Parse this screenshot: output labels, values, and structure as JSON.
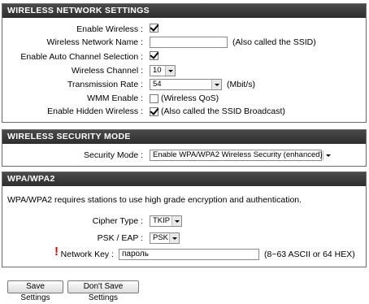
{
  "wireless": {
    "title": "WIRELESS NETWORK SETTINGS",
    "enable_wireless_label": "Enable Wireless :",
    "enable_wireless_checked": true,
    "network_name_label": "Wireless Network Name :",
    "network_name_value": "",
    "network_name_note": "(Also called the SSID)",
    "auto_channel_label": "Enable Auto Channel Selection :",
    "auto_channel_checked": true,
    "channel_label": "Wireless Channel :",
    "channel_value": "10",
    "rate_label": "Transmission Rate :",
    "rate_value": "54",
    "rate_unit": "(Mbit/s)",
    "wmm_label": "WMM Enable :",
    "wmm_checked": false,
    "wmm_note": "(Wireless QoS)",
    "hidden_label": "Enable Hidden Wireless :",
    "hidden_checked": true,
    "hidden_note": "(Also called the SSID Broadcast)"
  },
  "security": {
    "title": "WIRELESS SECURITY MODE",
    "mode_label": "Security Mode :",
    "mode_value": "Enable WPA/WPA2 Wireless Security (enhanced)"
  },
  "wpa": {
    "title": "WPA/WPA2",
    "description": "WPA/WPA2 requires stations to use high grade encryption and authentication.",
    "cipher_label": "Cipher Type :",
    "cipher_value": "TKIP",
    "psk_label": "PSK / EAP :",
    "psk_value": "PSK",
    "key_marker": "!",
    "key_label": "Network Key :",
    "key_value": "пароль",
    "key_note": "(8~63 ASCII or 64 HEX)"
  },
  "buttons": {
    "save": "Save Settings",
    "dont_save": "Don't Save Settings"
  }
}
